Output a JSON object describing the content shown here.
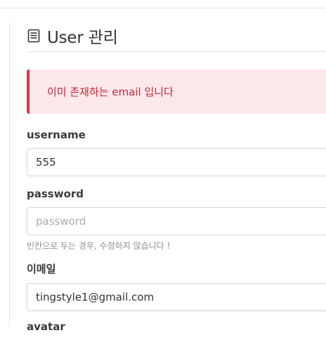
{
  "header": {
    "icon": "list-document-icon",
    "title": "User 관리"
  },
  "alert": {
    "message": "이미 존재하는 email 입니다",
    "color": "#dc3545"
  },
  "form": {
    "username": {
      "label": "username",
      "value": "555"
    },
    "password": {
      "label": "password",
      "placeholder": "password",
      "help": "빈칸으로 두는 경우, 수정하지 않습니다 !"
    },
    "email": {
      "label": "이메일",
      "value": "tingstyle1@gmail.com"
    },
    "next_field": {
      "label": "avatar"
    }
  }
}
